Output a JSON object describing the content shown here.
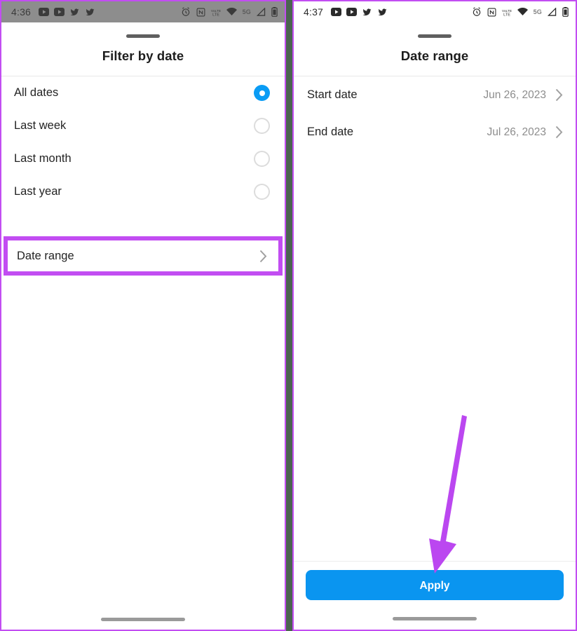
{
  "accent_purple": "#c24df2",
  "accent_blue": "#0a95f0",
  "radio_on_color": "#0a9cf5",
  "left_panel": {
    "status_bar": {
      "time": "4:36",
      "left_icons": [
        "youtube-icon",
        "youtube-icon",
        "twitter-icon",
        "twitter-icon"
      ],
      "right_icons": [
        "alarm-icon",
        "nfc-icon",
        "volte-icon",
        "wifi-icon",
        "5g-icon",
        "signal-icon",
        "battery-icon"
      ],
      "volte_label": "VoLTE",
      "network_label": "5G"
    },
    "title": "Filter by date",
    "options": [
      {
        "label": "All dates",
        "selected": true
      },
      {
        "label": "Last week",
        "selected": false
      },
      {
        "label": "Last month",
        "selected": false
      },
      {
        "label": "Last year",
        "selected": false
      }
    ],
    "date_range_row": {
      "label": "Date range",
      "chevron": "chevron-right-icon",
      "highlighted": true
    }
  },
  "right_panel": {
    "status_bar": {
      "time": "4:37",
      "left_icons": [
        "youtube-icon",
        "youtube-icon",
        "twitter-icon",
        "twitter-icon"
      ],
      "right_icons": [
        "alarm-icon",
        "nfc-icon",
        "volte-icon",
        "wifi-icon",
        "5g-icon",
        "signal-icon",
        "battery-icon"
      ],
      "volte_label": "VoLTE",
      "network_label": "5G"
    },
    "title": "Date range",
    "rows": [
      {
        "label": "Start date",
        "value": "Jun 26, 2023",
        "chevron": "chevron-right-icon"
      },
      {
        "label": "End date",
        "value": "Jul 26, 2023",
        "chevron": "chevron-right-icon"
      }
    ],
    "apply_label": "Apply"
  }
}
